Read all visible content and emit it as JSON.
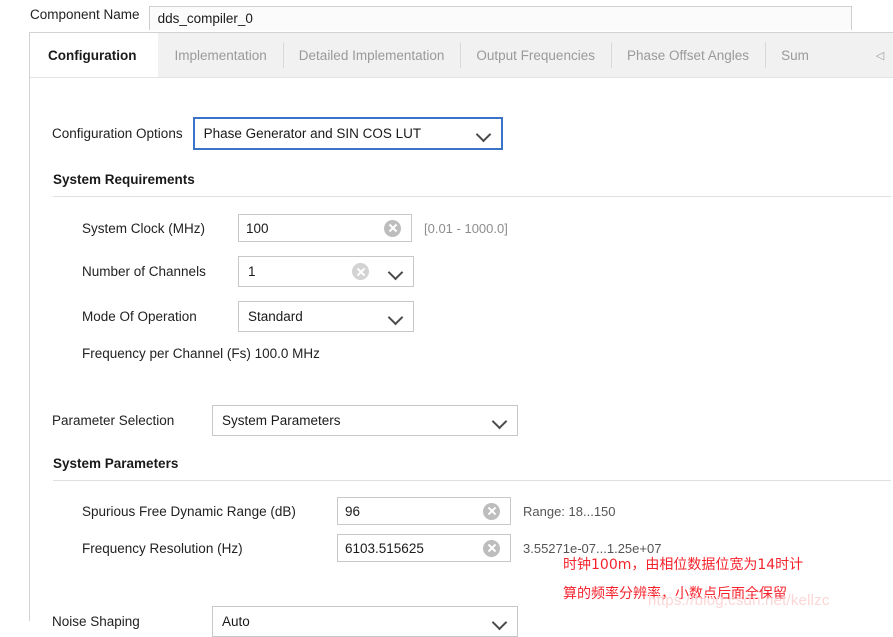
{
  "component": {
    "label": "Component Name",
    "value": "dds_compiler_0"
  },
  "tabs": [
    {
      "label": "Configuration",
      "active": true
    },
    {
      "label": "Implementation",
      "active": false
    },
    {
      "label": "Detailed Implementation",
      "active": false
    },
    {
      "label": "Output Frequencies",
      "active": false
    },
    {
      "label": "Phase Offset Angles",
      "active": false
    },
    {
      "label": "Sum",
      "active": false
    }
  ],
  "tab_scroll": {
    "left_arrow": "◁"
  },
  "configuration_options": {
    "label": "Configuration Options",
    "value": "Phase Generator and SIN COS LUT",
    "caret": "chevron-down-icon"
  },
  "system_requirements": {
    "heading": "System Requirements",
    "system_clock": {
      "label": "System Clock (MHz)",
      "value": "100",
      "range_hint": "[0.01 - 1000.0]",
      "clear_icon": "clear-circle-icon"
    },
    "number_of_channels": {
      "label": "Number of Channels",
      "value": "1",
      "clear_icon": "clear-circle-icon",
      "caret": "chevron-down-icon"
    },
    "mode_of_operation": {
      "label": "Mode Of Operation",
      "value": "Standard",
      "caret": "chevron-down-icon"
    },
    "frequency_per_channel": "Frequency per Channel (Fs) 100.0 MHz"
  },
  "parameter_selection": {
    "label": "Parameter Selection",
    "value": "System Parameters",
    "caret": "chevron-down-icon"
  },
  "system_parameters": {
    "heading": "System Parameters",
    "sfdr": {
      "label": "Spurious Free Dynamic Range (dB)",
      "value": "96",
      "range_hint": "Range: 18...150",
      "clear_icon": "clear-circle-icon"
    },
    "frequency_resolution": {
      "label": "Frequency Resolution (Hz)",
      "value": "6103.515625",
      "range_hint": "3.55271e-07...1.25e+07",
      "clear_icon": "clear-circle-icon"
    },
    "noise_shaping": {
      "label": "Noise Shaping",
      "value": "Auto",
      "caret": "chevron-down-icon"
    }
  },
  "annotation": {
    "text": "时钟100m，由相位数据位宽为14时计\n算的频率分辨率，小数点后面全保留",
    "color": "#f5232c"
  },
  "watermark": {
    "text": "https://blog.csdn.net/kellzc"
  }
}
